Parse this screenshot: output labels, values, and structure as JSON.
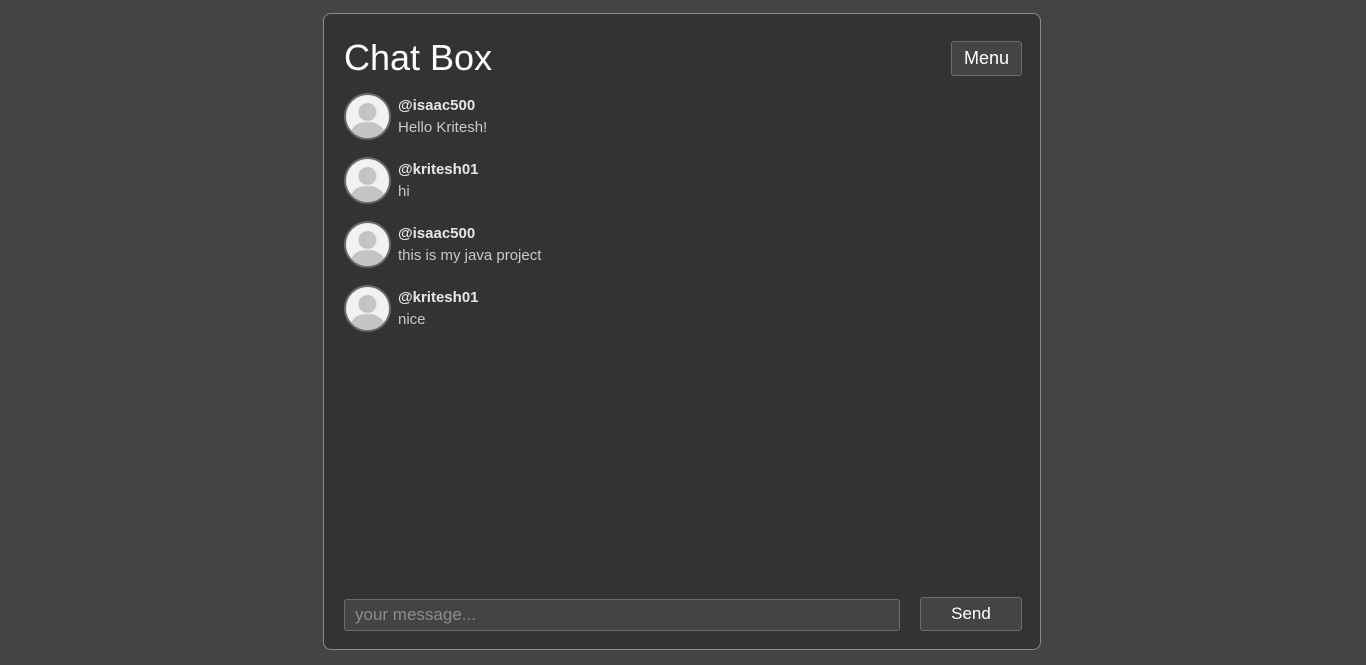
{
  "header": {
    "title": "Chat Box",
    "menu_label": "Menu"
  },
  "messages": [
    {
      "username": "@isaac500",
      "text": "Hello Kritesh!",
      "avatar_icon": "user-avatar-icon"
    },
    {
      "username": "@kritesh01",
      "text": "hi",
      "avatar_icon": "user-avatar-icon"
    },
    {
      "username": "@isaac500",
      "text": "this is my java project",
      "avatar_icon": "user-avatar-icon"
    },
    {
      "username": "@kritesh01",
      "text": "nice",
      "avatar_icon": "user-avatar-icon"
    }
  ],
  "composer": {
    "placeholder": "your message...",
    "value": "",
    "send_label": "Send"
  },
  "colors": {
    "page_background": "#444444",
    "panel_background": "#333333",
    "panel_border": "#8a8a8a",
    "text_primary": "#ffffff"
  }
}
